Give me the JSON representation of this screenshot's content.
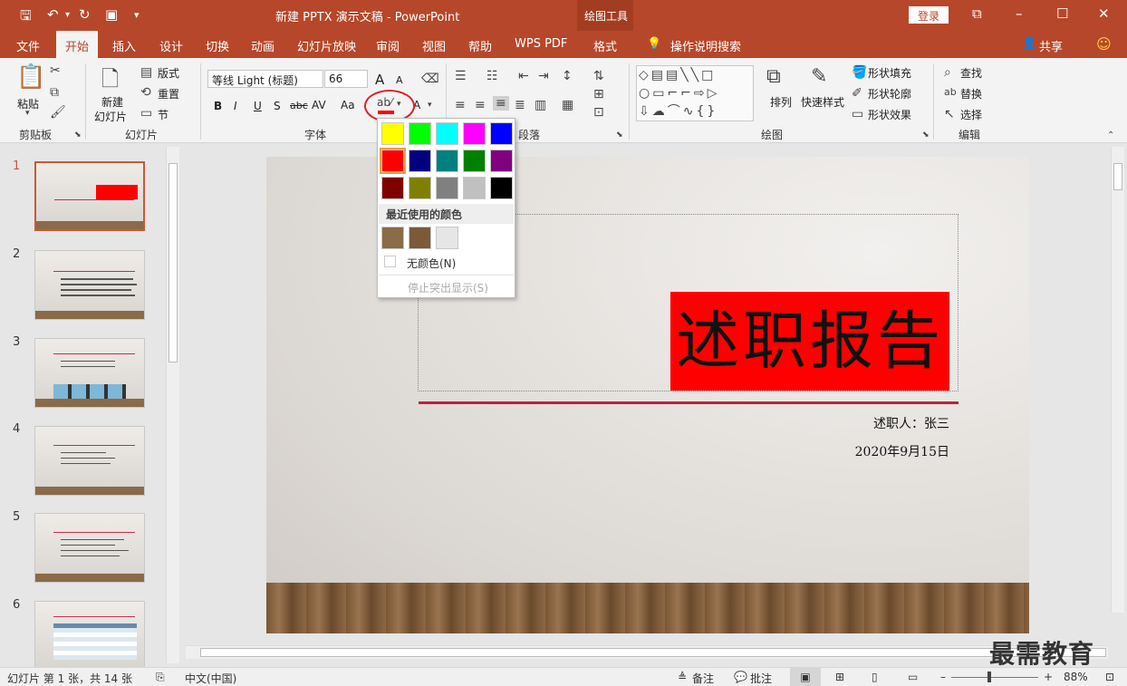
{
  "titlebar": {
    "title": "新建 PPTX 演示文稿  -  PowerPoint",
    "context_group": "绘图工具",
    "login": "登录"
  },
  "tabs": [
    "文件",
    "开始",
    "插入",
    "设计",
    "切换",
    "动画",
    "幻灯片放映",
    "审阅",
    "视图",
    "帮助",
    "WPS PDF",
    "格式"
  ],
  "active_tab": "开始",
  "tellme": "操作说明搜索",
  "share": "共享",
  "ribbon": {
    "clipboard": {
      "label": "剪贴板",
      "paste": "粘贴"
    },
    "slides": {
      "label": "幻灯片",
      "new_slide_1": "新建",
      "new_slide_2": "幻灯片",
      "layout": "版式",
      "reset": "重置",
      "section": "节"
    },
    "font": {
      "label": "字体",
      "font_name": "等线 Light (标题)",
      "font_size": "66",
      "bold": "B",
      "italic": "I",
      "underline": "U",
      "shadow": "S",
      "strike": "abc",
      "spacing": "AV",
      "case": "Aa",
      "grow": "A",
      "shrink": "A"
    },
    "paragraph": {
      "label": "段落"
    },
    "drawing": {
      "label": "绘图",
      "arrange": "排列",
      "quick_styles": "快速样式",
      "fill": "形状填充",
      "outline": "形状轮廓",
      "effects": "形状效果"
    },
    "editing": {
      "label": "编辑",
      "find": "查找",
      "replace": "替换",
      "select": "选择"
    }
  },
  "popup": {
    "standard_colors": [
      "#ffff00",
      "#00ff00",
      "#00ffff",
      "#ff00ff",
      "#0000ff",
      "#ff0000",
      "#000080",
      "#008080",
      "#008000",
      "#800080",
      "#800000",
      "#808000",
      "#808080",
      "#c0c0c0",
      "#000000"
    ],
    "recent_header": "最近使用的颜色",
    "recent_colors": [
      "#8b6b48",
      "#7a5a38",
      "#e6e6e6"
    ],
    "no_color": "无颜色(N)",
    "stop_highlight": "停止突出显示(S)"
  },
  "thumbnails": [
    "1",
    "2",
    "3",
    "4",
    "5",
    "6"
  ],
  "slide": {
    "title": "述职报告",
    "presenter": "述职人：张三",
    "date": "2020年9月15日"
  },
  "status": {
    "slide_info": "幻灯片 第 1 张，共 14 张",
    "language": "中文(中国)",
    "notes": "备注",
    "comments": "批注",
    "zoom": "88%"
  },
  "watermark": "最需教育"
}
